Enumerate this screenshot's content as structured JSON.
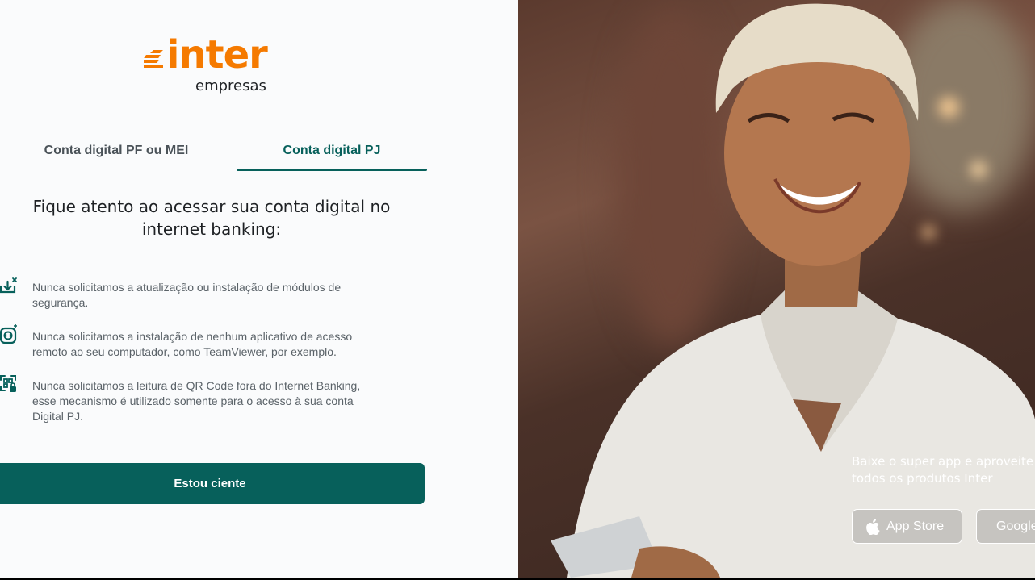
{
  "brand": {
    "name": "inter",
    "sub": "empresas",
    "color": "#f57a00"
  },
  "tabs": [
    {
      "label": "Conta digital PF ou MEI",
      "active": false
    },
    {
      "label": "Conta digital PJ",
      "active": true
    }
  ],
  "heading_line1": "Fique atento ao acessar sua conta digital no",
  "heading_line2": "internet banking:",
  "notices": [
    {
      "icon": "download-module-icon",
      "line1": "Nunca solicitamos a atualização ou instalação de módulos de",
      "line2": "segurança.",
      "line3": ""
    },
    {
      "icon": "remote-access-icon",
      "line1": "Nunca solicitamos a instalação de nenhum aplicativo de acesso",
      "line2": "remoto ao seu computador, como TeamViewer, por exemplo.",
      "line3": ""
    },
    {
      "icon": "qr-code-lock-icon",
      "line1": "Nunca solicitamos a leitura de QR Code fora do Internet Banking,",
      "line2": "esse mecanismo é utilizado somente para o acesso à sua conta",
      "line3": "Digital PJ."
    }
  ],
  "confirm_label": "Estou ciente",
  "promo_line1": "Baixe o super app e aproveite",
  "promo_line2": "todos os produtos Inter",
  "app_store_label": "App Store",
  "google_play_label": "Google Play",
  "accent_color": "#07605b"
}
